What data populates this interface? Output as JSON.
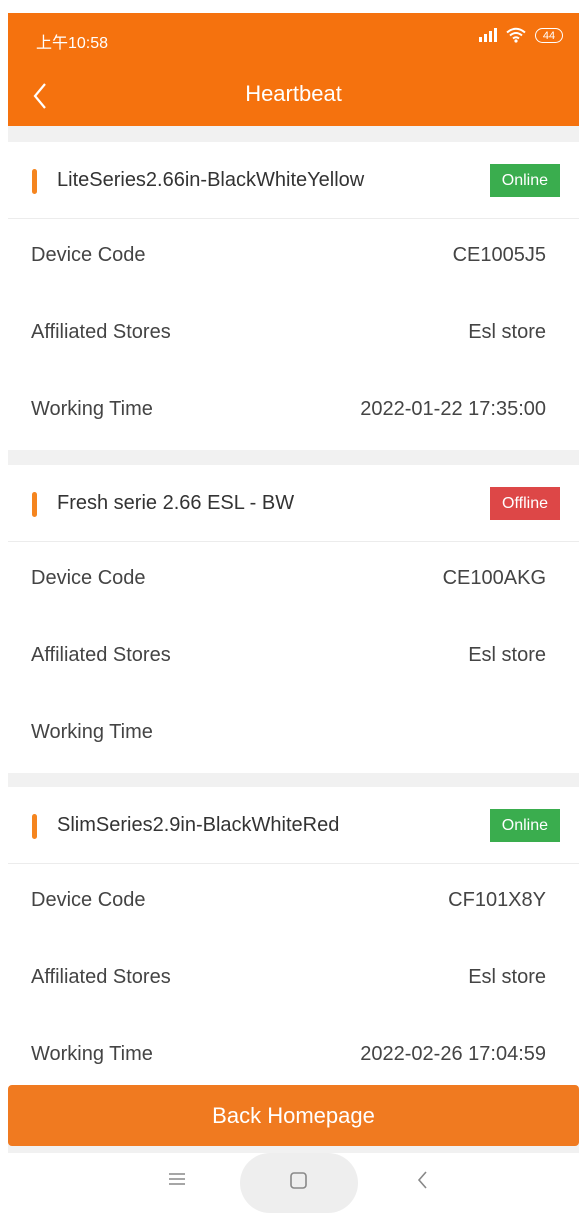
{
  "status_bar": {
    "time": "上午10:58",
    "battery": "44"
  },
  "header": {
    "title": "Heartbeat"
  },
  "labels": {
    "device_code": "Device Code",
    "affiliated_stores": "Affiliated Stores",
    "working_time": "Working Time"
  },
  "devices": [
    {
      "name": "LiteSeries2.66in-BlackWhiteYellow",
      "status": "Online",
      "status_color": "#3aad4e",
      "device_code": "CE1005J5",
      "store": "Esl store",
      "working_time": "2022-01-22 17:35:00"
    },
    {
      "name": "Fresh serie 2.66 ESL - BW",
      "status": "Offline",
      "status_color": "#dd4747",
      "device_code": "CE100AKG",
      "store": "Esl store",
      "working_time": ""
    },
    {
      "name": "SlimSeries2.9in-BlackWhiteRed",
      "status": "Online",
      "status_color": "#3aad4e",
      "device_code": "CF101X8Y",
      "store": "Esl store",
      "working_time": "2022-02-26 17:04:59"
    }
  ],
  "footer": {
    "back_home_label": "Back Homepage"
  },
  "colors": {
    "header": "#f5720e",
    "accent": "#f5851f",
    "button": "#f07a20"
  },
  "icons": {
    "back": "chevron-left-icon",
    "signal": "signal-icon",
    "wifi": "wifi-icon",
    "battery": "battery-icon",
    "menu": "menu-icon",
    "home": "home-icon",
    "nav_back": "back-icon"
  }
}
